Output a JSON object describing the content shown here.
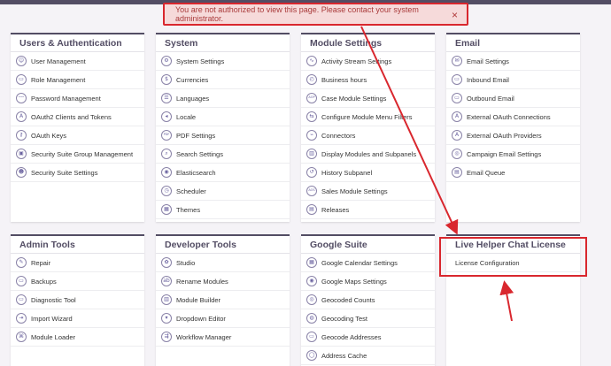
{
  "alert": {
    "message": "You are not authorized to view this page. Please contact your system administrator.",
    "close": "×"
  },
  "panels": {
    "users_auth": {
      "title": "Users & Authentication",
      "items": [
        {
          "label": "User Management",
          "icon": "user-icon",
          "glyph": "☺"
        },
        {
          "label": "Role Management",
          "icon": "role-icon",
          "glyph": "▭"
        },
        {
          "label": "Password Management",
          "icon": "password-icon",
          "glyph": "•••"
        },
        {
          "label": "OAuth2 Clients and Tokens",
          "icon": "oauth2-icon",
          "glyph": "A"
        },
        {
          "label": "OAuth Keys",
          "icon": "key-icon",
          "glyph": "⚷"
        },
        {
          "label": "Security Suite Group Management",
          "icon": "lock-icon",
          "glyph": "▣"
        },
        {
          "label": "Security Suite Settings",
          "icon": "users-icon",
          "glyph": "☻"
        }
      ]
    },
    "system": {
      "title": "System",
      "items": [
        {
          "label": "System Settings",
          "icon": "gear-icon",
          "glyph": "⚙"
        },
        {
          "label": "Currencies",
          "icon": "currency-icon",
          "glyph": "$"
        },
        {
          "label": "Languages",
          "icon": "language-icon",
          "glyph": "☰"
        },
        {
          "label": "Locale",
          "icon": "locale-icon",
          "glyph": "◂"
        },
        {
          "label": "PDF Settings",
          "icon": "pdf-icon",
          "glyph": "PDF"
        },
        {
          "label": "Search Settings",
          "icon": "search-icon",
          "glyph": "⌕"
        },
        {
          "label": "Elasticsearch",
          "icon": "elasticsearch-icon",
          "glyph": "◉"
        },
        {
          "label": "Scheduler",
          "icon": "scheduler-icon",
          "glyph": "◷"
        },
        {
          "label": "Themes",
          "icon": "themes-icon",
          "glyph": "▦"
        }
      ]
    },
    "module_settings": {
      "title": "Module Settings",
      "items": [
        {
          "label": "Activity Stream Settings",
          "icon": "activity-stream-icon",
          "glyph": "∿"
        },
        {
          "label": "Business hours",
          "icon": "clock-icon",
          "glyph": "◴"
        },
        {
          "label": "Case Module Settings",
          "icon": "case-icon",
          "glyph": "AOP"
        },
        {
          "label": "Configure Module Menu Filters",
          "icon": "filter-icon",
          "glyph": "⇆"
        },
        {
          "label": "Connectors",
          "icon": "connectors-icon",
          "glyph": "⌁"
        },
        {
          "label": "Display Modules and Subpanels",
          "icon": "display-modules-icon",
          "glyph": "▥"
        },
        {
          "label": "History Subpanel",
          "icon": "history-icon",
          "glyph": "↺"
        },
        {
          "label": "Sales Module Settings",
          "icon": "sales-icon",
          "glyph": "AOS"
        },
        {
          "label": "Releases",
          "icon": "releases-icon",
          "glyph": "▤"
        }
      ]
    },
    "email": {
      "title": "Email",
      "items": [
        {
          "label": "Email Settings",
          "icon": "email-settings-icon",
          "glyph": "✉"
        },
        {
          "label": "Inbound Email",
          "icon": "inbound-email-icon",
          "glyph": "▭"
        },
        {
          "label": "Outbound Email",
          "icon": "outbound-email-icon",
          "glyph": "▭"
        },
        {
          "label": "External OAuth Connections",
          "icon": "oauth-connections-icon",
          "glyph": "A"
        },
        {
          "label": "External OAuth Providers",
          "icon": "oauth-providers-icon",
          "glyph": "A"
        },
        {
          "label": "Campaign Email Settings",
          "icon": "campaign-icon",
          "glyph": "◎"
        },
        {
          "label": "Email Queue",
          "icon": "email-queue-icon",
          "glyph": "▤"
        }
      ]
    },
    "admin_tools": {
      "title": "Admin Tools",
      "items": [
        {
          "label": "Repair",
          "icon": "wrench-icon",
          "glyph": "✎"
        },
        {
          "label": "Backups",
          "icon": "backups-icon",
          "glyph": "▭"
        },
        {
          "label": "Diagnostic Tool",
          "icon": "diagnostic-icon",
          "glyph": "▭"
        },
        {
          "label": "Import Wizard",
          "icon": "import-icon",
          "glyph": "⇥"
        },
        {
          "label": "Module Loader",
          "icon": "module-loader-icon",
          "glyph": "⌘"
        }
      ]
    },
    "developer_tools": {
      "title": "Developer Tools",
      "items": [
        {
          "label": "Studio",
          "icon": "studio-icon",
          "glyph": "✿"
        },
        {
          "label": "Rename Modules",
          "icon": "rename-icon",
          "glyph": "ab"
        },
        {
          "label": "Module Builder",
          "icon": "module-builder-icon",
          "glyph": "▥"
        },
        {
          "label": "Dropdown Editor",
          "icon": "dropdown-editor-icon",
          "glyph": "▾"
        },
        {
          "label": "Workflow Manager",
          "icon": "workflow-icon",
          "glyph": "⇶"
        }
      ]
    },
    "google_suite": {
      "title": "Google Suite",
      "items": [
        {
          "label": "Google Calendar Settings",
          "icon": "calendar-icon",
          "glyph": "▦"
        },
        {
          "label": "Google Maps Settings",
          "icon": "map-pin-icon",
          "glyph": "◉"
        },
        {
          "label": "Geocoded Counts",
          "icon": "geocoded-counts-icon",
          "glyph": "◎"
        },
        {
          "label": "Geocoding Test",
          "icon": "geocoding-test-icon",
          "glyph": "◍"
        },
        {
          "label": "Geocode Addresses",
          "icon": "geocode-addresses-icon",
          "glyph": "▭"
        },
        {
          "label": "Address Cache",
          "icon": "address-cache-icon",
          "glyph": "◯"
        }
      ]
    },
    "live_helper": {
      "title": "Live Helper Chat License",
      "items": [
        {
          "label": "License Configuration",
          "icon": "",
          "glyph": ""
        }
      ]
    }
  },
  "colors": {
    "header_bar": "#534d64",
    "annotation_red": "#d9272e",
    "panel_title": "#534d64",
    "alert_bg": "#f6dada"
  }
}
